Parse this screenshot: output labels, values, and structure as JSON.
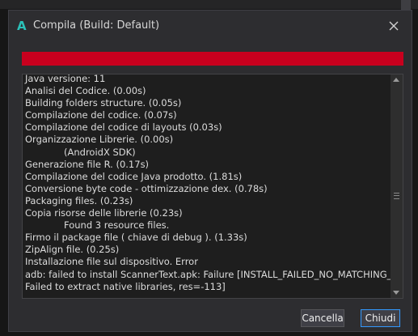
{
  "window": {
    "title": "Compila (Build: Default)",
    "app_icon_glyph": "A",
    "icons": [
      "app-logo-icon",
      "close-icon",
      "scroll-up-icon",
      "scroll-down-icon"
    ]
  },
  "progress": {
    "value": 1.0,
    "color": "#c8001e"
  },
  "log": {
    "lines": [
      {
        "text": "Java versione: 11",
        "indent": false
      },
      {
        "text": "Analisi del Codice.    (0.00s)",
        "indent": false
      },
      {
        "text": "Building folders structure.    (0.05s)",
        "indent": false
      },
      {
        "text": "Compilazione del codice.    (0.07s)",
        "indent": false
      },
      {
        "text": "Compilazione del codice di layouts    (0.03s)",
        "indent": false
      },
      {
        "text": "Organizzazione Librerie.    (0.00s)",
        "indent": false
      },
      {
        "text": "(AndroidX SDK)",
        "indent": true
      },
      {
        "text": "Generazione file R.    (0.17s)",
        "indent": false
      },
      {
        "text": "Compilazione del codice Java prodotto.    (1.81s)",
        "indent": false
      },
      {
        "text": "Conversione byte code - ottimizzazione dex.    (0.78s)",
        "indent": false
      },
      {
        "text": "Packaging files.    (0.23s)",
        "indent": false
      },
      {
        "text": "Copia risorse delle librerie    (0.23s)",
        "indent": false
      },
      {
        "text": "Found 3 resource files.",
        "indent": true
      },
      {
        "text": "Firmo il package file ( chiave di debug ).    (1.33s)",
        "indent": false
      },
      {
        "text": "ZipAlign file.    (0.25s)",
        "indent": false
      },
      {
        "text": "Installazione file sul dispositivo.    Error",
        "indent": false
      },
      {
        "text": "adb: failed to install ScannerText.apk: Failure [INSTALL_FAILED_NO_MATCHING_ABIS:",
        "indent": false
      },
      {
        "text": "Failed to extract native libraries, res=-113]",
        "indent": false
      }
    ]
  },
  "buttons": {
    "cancel_label": "Cancella",
    "close_label": "Chiudi"
  },
  "colors": {
    "accent": "#3399ff",
    "progress_error": "#c8001e",
    "app_icon": "#2bc1b9"
  }
}
